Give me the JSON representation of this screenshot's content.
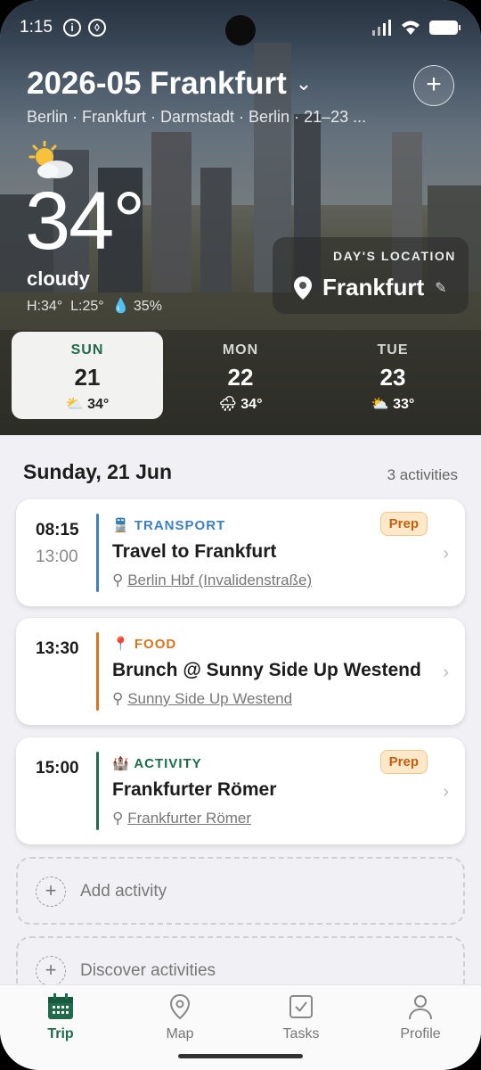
{
  "status": {
    "time": "1:15"
  },
  "header": {
    "title": "2026-05 Frankfurt",
    "subtitle": "Berlin · Frankfurt · Darmstadt · Berlin · 21–23 ..."
  },
  "weather": {
    "icon": "partly-cloudy-icon",
    "temp": "34°",
    "condition": "cloudy",
    "high": "H:34°",
    "low": "L:25°",
    "rain": "35%"
  },
  "location": {
    "label": "DAY'S LOCATION",
    "name": "Frankfurt"
  },
  "days": [
    {
      "name": "SUN",
      "date": "21",
      "temp": "34°",
      "icon": "⛅",
      "selected": true
    },
    {
      "name": "MON",
      "date": "22",
      "temp": "34°",
      "icon": "🌧",
      "selected": false
    },
    {
      "name": "TUE",
      "date": "23",
      "temp": "33°",
      "icon": "⛅",
      "selected": false
    }
  ],
  "day_header": {
    "date": "Sunday, 21 Jun",
    "count": "3 activities"
  },
  "activities": [
    {
      "start": "08:15",
      "end": "13:00",
      "category": "TRANSPORT",
      "icon": "🚆",
      "title": "Travel to Frankfurt",
      "place": "Berlin Hbf (Invalidenstraße)",
      "badge": "Prep",
      "color": "#3a7fc0"
    },
    {
      "start": "13:30",
      "end": "",
      "category": "FOOD",
      "icon": "📍",
      "title": "Brunch @ Sunny Side Up Westend",
      "place": "Sunny Side Up Westend",
      "badge": "",
      "color": "#d9741c"
    },
    {
      "start": "15:00",
      "end": "",
      "category": "ACTIVITY",
      "icon": "🏰",
      "title": "Frankfurter Römer",
      "place": "Frankfurter Römer",
      "badge": "Prep",
      "color": "#1f6b4c"
    }
  ],
  "actions": {
    "add": "Add activity",
    "discover": "Discover activities"
  },
  "nav": [
    {
      "label": "Trip",
      "active": true
    },
    {
      "label": "Map",
      "active": false
    },
    {
      "label": "Tasks",
      "active": false
    },
    {
      "label": "Profile",
      "active": false
    }
  ]
}
